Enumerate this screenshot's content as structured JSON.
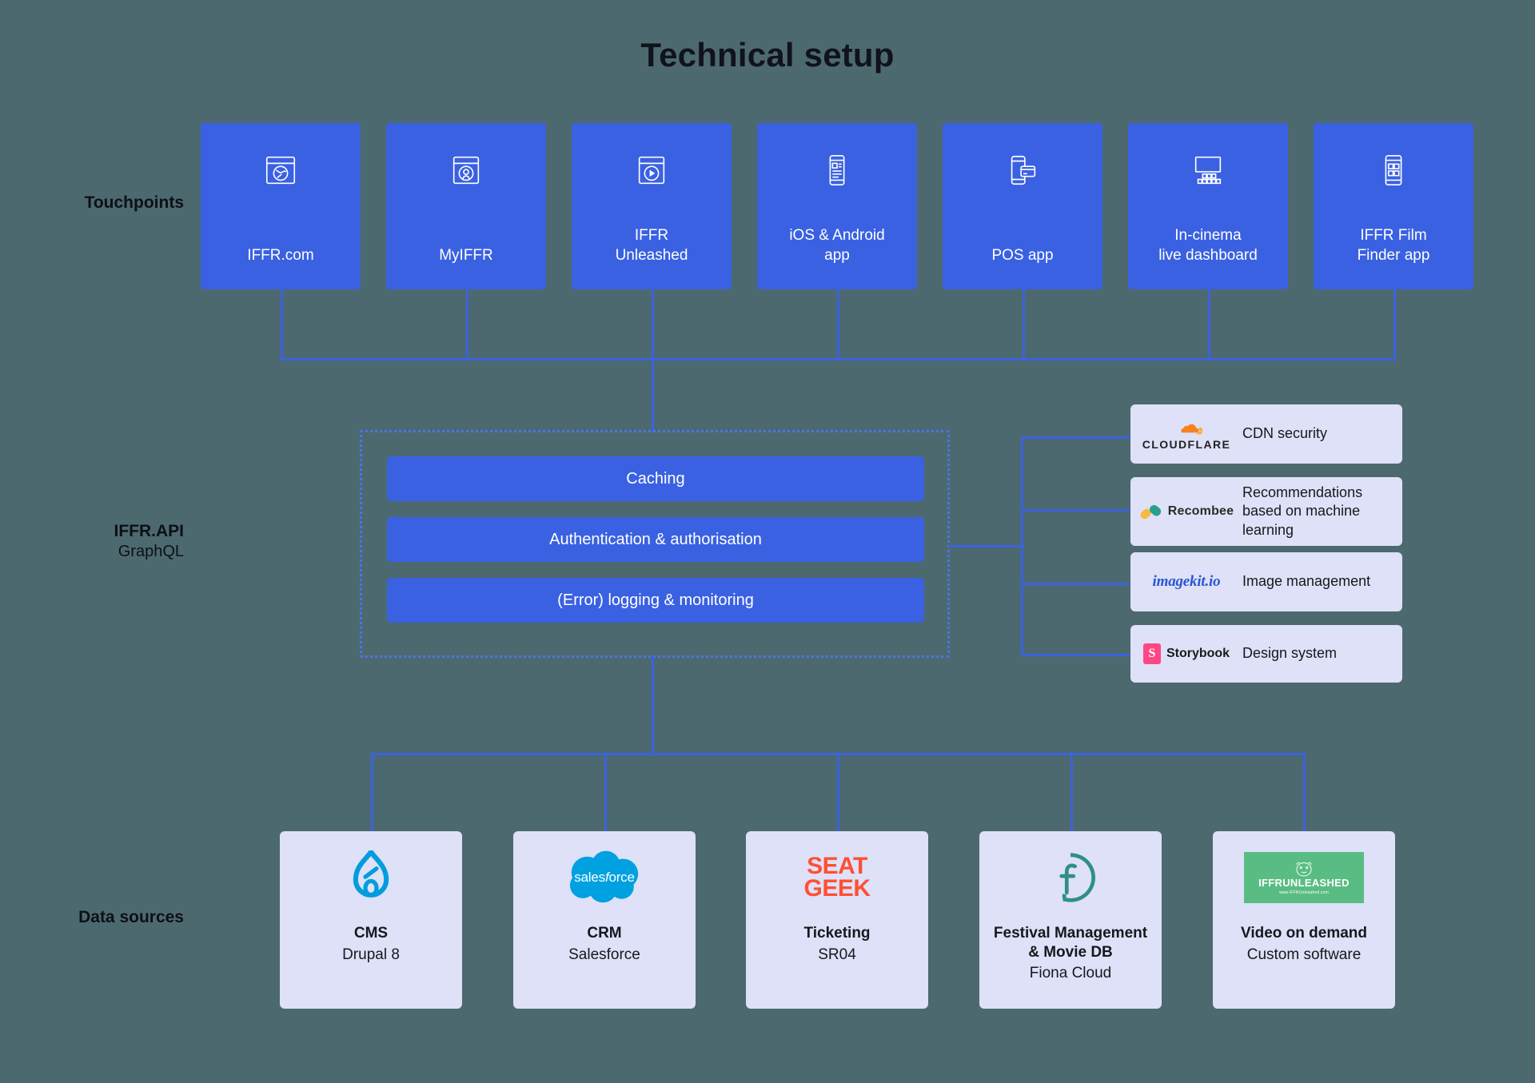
{
  "page": {
    "title": "Technical setup",
    "background_color": "#4d6970",
    "accent_blue": "#3a61e2",
    "card_light": "#dee1f7"
  },
  "rows": {
    "touchpoints_label": "Touchpoints",
    "api_label": "IFFR.API",
    "api_sublabel": "GraphQL",
    "datasources_label": "Data sources"
  },
  "touchpoints": [
    {
      "label": "IFFR.com",
      "icon": "browser-globe-icon"
    },
    {
      "label": "MyIFFR",
      "icon": "browser-user-icon"
    },
    {
      "label": "IFFR\nUnleashed",
      "icon": "browser-play-icon"
    },
    {
      "label": "iOS & Android\napp",
      "icon": "mobile-article-icon"
    },
    {
      "label": "POS app",
      "icon": "mobile-card-payment-icon"
    },
    {
      "label": "In-cinema\nlive dashboard",
      "icon": "screen-seats-icon"
    },
    {
      "label": "IFFR Film\nFinder app",
      "icon": "mobile-grid-icon"
    }
  ],
  "api_layers": [
    "Caching",
    "Authentication & authorisation",
    "(Error) logging & monitoring"
  ],
  "services": [
    {
      "brand": "CLOUDFLARE",
      "logo": "cloudflare-logo",
      "desc": "CDN security"
    },
    {
      "brand": "Recombee",
      "logo": "recombee-logo",
      "desc": "Recommendations\nbased on machine\nlearning"
    },
    {
      "brand": "imagekit.io",
      "logo": "imagekit-logo",
      "desc": "Image management"
    },
    {
      "brand": "Storybook",
      "logo": "storybook-logo",
      "desc": "Design system"
    }
  ],
  "data_sources": [
    {
      "logo": "drupal-logo",
      "title": "CMS",
      "sub": "Drupal 8"
    },
    {
      "logo": "salesforce-logo",
      "title": "CRM",
      "sub": "Salesforce"
    },
    {
      "logo": "seatgeek-logo",
      "title": "Ticketing",
      "sub": "SR04",
      "logo_text_top": "SEAT",
      "logo_text_bottom": "GEEK"
    },
    {
      "logo": "fiona-logo",
      "title": "Festival Management\n& Movie DB",
      "sub": "Fiona Cloud"
    },
    {
      "logo": "iffr-unleashed-logo",
      "title": "Video on demand",
      "sub": "Custom software",
      "logo_text_main": "IFFRUNLEASHED",
      "logo_text_sub": "www.IFFRUnleashed.com"
    }
  ]
}
